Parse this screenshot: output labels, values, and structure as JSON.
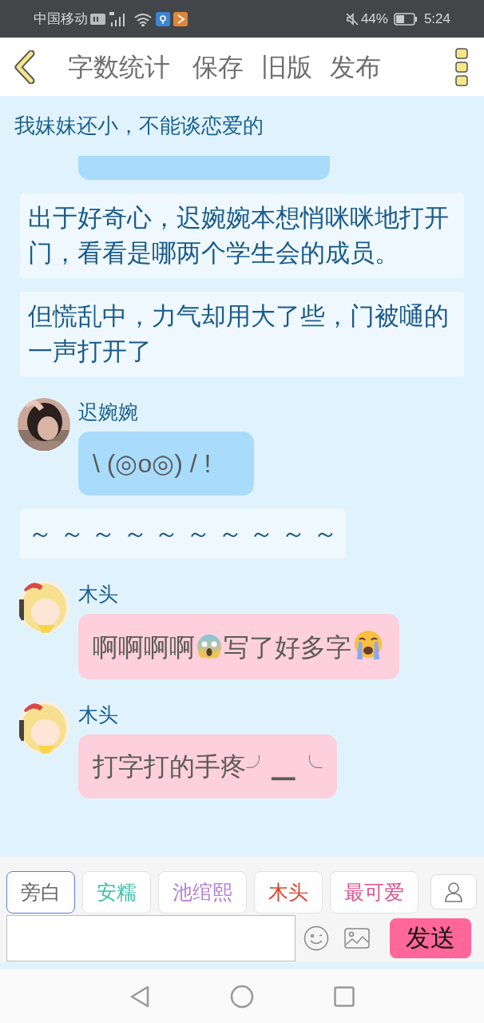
{
  "status_bar": {
    "carrier": "中国移动",
    "battery": "44%",
    "time": "5:24"
  },
  "toolbar": {
    "actions": [
      "字数统计",
      "保存",
      "旧版",
      "发布"
    ]
  },
  "messages": [
    {
      "kind": "plain",
      "text": "我妹妹还小，不能谈恋爱的"
    },
    {
      "kind": "cut_bubble",
      "color": "#a8dcfa"
    },
    {
      "kind": "narration",
      "text": "出于好奇心，迟婉婉本想悄咪咪地打开门，看看是哪两个学生会的成员。"
    },
    {
      "kind": "narration",
      "text": "但慌乱中，力气却用大了些，门被嗵的一声打开了"
    },
    {
      "kind": "message",
      "sender": "迟婉婉",
      "color": "#a8dcfa",
      "segments": [
        {
          "kind": "text",
          "text": "\\ (◎o◎) / !"
        }
      ]
    },
    {
      "kind": "narration",
      "text": "～ ～ ～ ～ ～ ～ ～ ～ ～ ～"
    },
    {
      "kind": "message",
      "sender": "木头",
      "color": "#fecfdc",
      "segments": [
        {
          "kind": "text",
          "text": "啊啊啊啊"
        },
        {
          "kind": "fear_emoji"
        },
        {
          "kind": "text",
          "text": "写了好多字"
        },
        {
          "kind": "crying_emoji"
        }
      ]
    },
    {
      "kind": "message",
      "sender": "木头",
      "color": "#fecfdc",
      "segments": [
        {
          "kind": "text",
          "text": "打字打的手疼╯▁╰"
        }
      ]
    }
  ],
  "characters": [
    {
      "name": "旁白",
      "selected": true,
      "color": "#666666"
    },
    {
      "name": "安糯",
      "selected": false,
      "color": "#3dbfa6"
    },
    {
      "name": "池绾熙",
      "selected": false,
      "color": "#b57ed8"
    },
    {
      "name": "木头",
      "selected": false,
      "color": "#d9472f"
    },
    {
      "name": "最可爱",
      "selected": false,
      "color": "#e0548f"
    }
  ],
  "composer": {
    "send": "发送"
  }
}
